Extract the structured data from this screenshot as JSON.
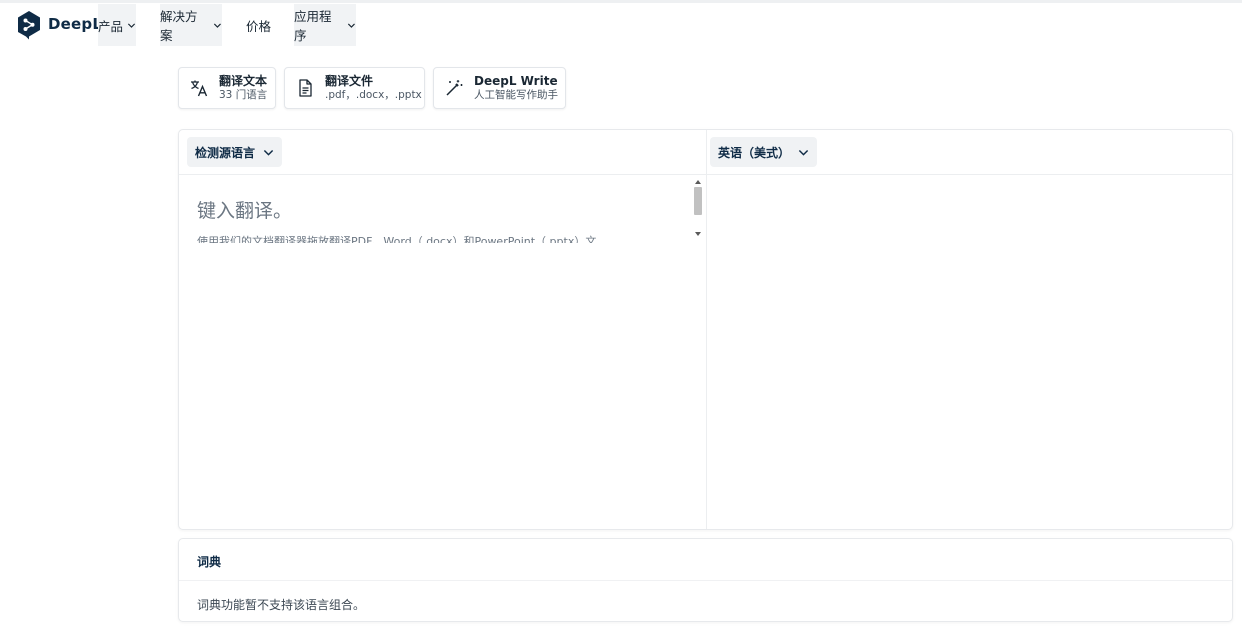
{
  "header": {
    "brand": "DeepL",
    "nav": [
      {
        "label": "产品"
      },
      {
        "label": "解决方案"
      },
      {
        "label": "价格"
      },
      {
        "label": "应用程序"
      }
    ]
  },
  "modes": [
    {
      "title": "翻译文本",
      "subtitle": "33 门语言",
      "icon": "translate-icon"
    },
    {
      "title": "翻译文件",
      "subtitle": ".pdf，.docx，.pptx",
      "icon": "document-icon"
    },
    {
      "title": "DeepL Write",
      "subtitle": "人工智能写作助手",
      "icon": "magic-wand-icon"
    }
  ],
  "translator": {
    "source_language": "检测源语言",
    "target_language": "英语（美式）",
    "placeholder": "键入翻译。",
    "hint": "使用我们的文档翻译器拖放翻译PDF、Word（.docx）和PowerPoint（.pptx）文"
  },
  "dictionary": {
    "title": "词典",
    "message": "词典功能暂不支持该语言组合。"
  },
  "colors": {
    "brand": "#0f2b46",
    "panel_border": "#e7e9ec",
    "lang_button_bg": "#f0f2f4"
  }
}
